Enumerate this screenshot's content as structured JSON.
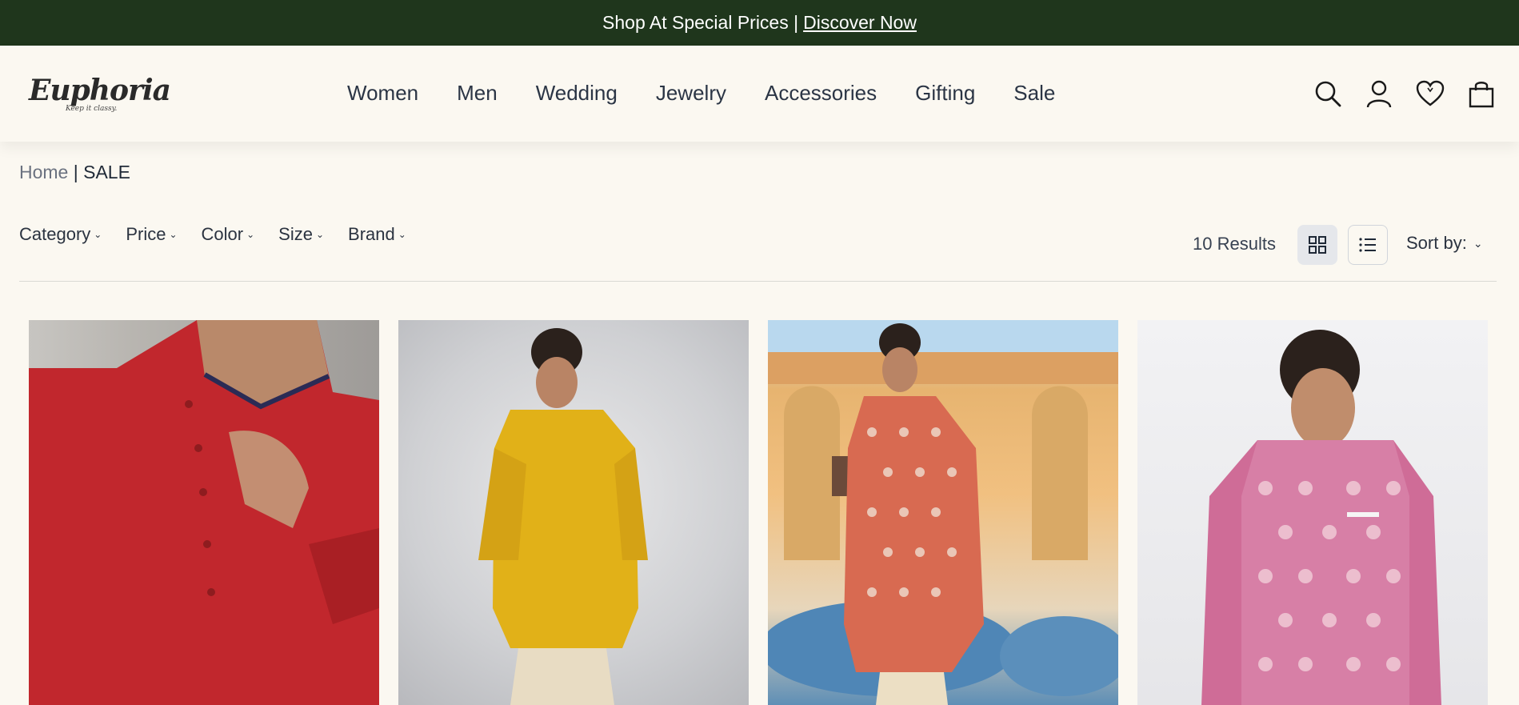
{
  "announcement": {
    "text": "Shop At Special Prices |",
    "link": " Discover Now"
  },
  "logo": {
    "name": "Euphoria",
    "tagline": "Keep it classy."
  },
  "nav": [
    "Women",
    "Men",
    "Wedding",
    "Jewelry",
    "Accessories",
    "Gifting",
    "Sale"
  ],
  "header_icons": [
    "search-icon",
    "account-icon",
    "wishlist-icon",
    "cart-icon"
  ],
  "breadcrumb": {
    "home": "Home",
    "separator": " | ",
    "current": "SALE"
  },
  "filters": [
    "Category",
    "Price",
    "Color",
    "Size",
    "Brand"
  ],
  "toolbar": {
    "results": "10 Results",
    "sort_label": "Sort by:"
  },
  "products": [
    {
      "image": "red kurta"
    },
    {
      "image": "mustard bandhgala kurta set"
    },
    {
      "image": "red printed kurta set in courtyard"
    },
    {
      "image": "pink floral nehru jacket"
    }
  ],
  "colors": {
    "announcement_bg": "#1f361c",
    "page_bg": "#fbf8f1",
    "text": "#2b3340"
  }
}
